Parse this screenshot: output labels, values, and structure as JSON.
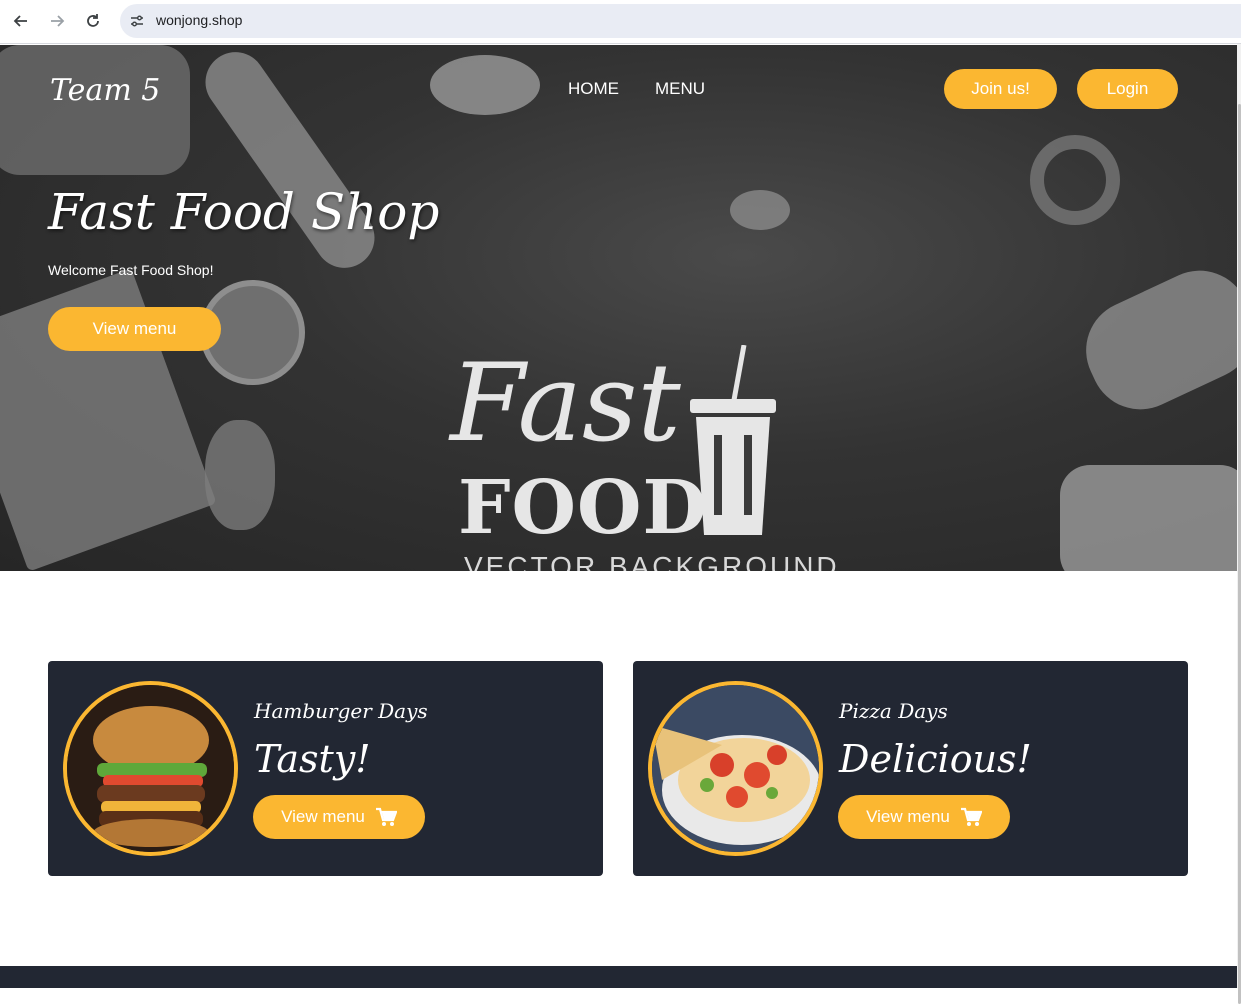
{
  "browser": {
    "url": "wonjong.shop",
    "icons": {
      "back": "arrow-left-icon",
      "forward": "arrow-right-icon",
      "reload": "reload-icon",
      "site_info": "tune-icon"
    }
  },
  "header": {
    "brand": "Team 5",
    "nav": [
      {
        "label": "HOME"
      },
      {
        "label": "MENU"
      }
    ],
    "join_label": "Join us!",
    "login_label": "Login"
  },
  "hero": {
    "title": "Fast Food Shop",
    "subtitle": "Welcome Fast Food Shop!",
    "cta_label": "View menu",
    "art": {
      "line1": "Fast",
      "line2": "FOOD",
      "line3": "VECTOR BACKGROUND"
    }
  },
  "cards": [
    {
      "kicker": "Hamburger Days",
      "headline": "Tasty!",
      "button_label": "View menu",
      "icon": "cart-icon"
    },
    {
      "kicker": "Pizza Days",
      "headline": "Delicious!",
      "button_label": "View menu",
      "icon": "cart-icon"
    }
  ],
  "colors": {
    "accent": "#fbb731",
    "card_bg": "#222733",
    "text_light": "#ffffff"
  }
}
